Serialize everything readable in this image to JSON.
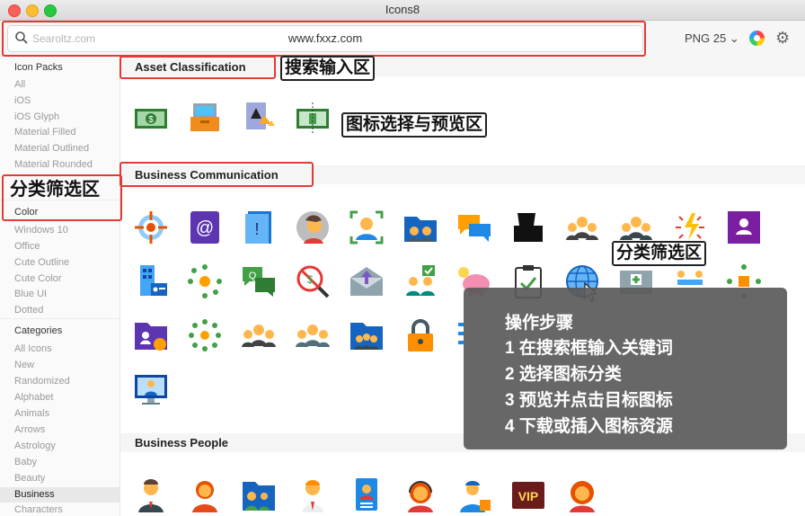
{
  "window": {
    "title": "Icons8"
  },
  "toolbar": {
    "search_placeholder": "Searoltz.com",
    "search_value": "www.fxxz.com",
    "format_label": "PNG 25 ⌄",
    "icons": [
      "search-icon",
      "color-picker-icon",
      "gear-icon"
    ]
  },
  "sidebar": {
    "icon_packs_title": "Icon Packs",
    "packs": [
      "All",
      "iOS",
      "iOS Glyph",
      "Material Filled",
      "Material Outlined",
      "Material Rounded"
    ],
    "color_title": "Color",
    "color_packs": [
      "Windows 10",
      "Office",
      "Cute Outline",
      "Cute Color",
      "Blue UI",
      "Dotted"
    ],
    "categories_title": "Categories",
    "categories": [
      "All Icons",
      "New",
      "Randomized",
      "Alphabet",
      "Animals",
      "Arrows",
      "Astrology",
      "Baby",
      "Beauty",
      "Business",
      "Characters"
    ],
    "selected_category": "Business"
  },
  "sections": {
    "asset": "Asset Classification",
    "communication": "Business Communication",
    "people": "Business People"
  },
  "annotations": {
    "search_area": "搜索输入区",
    "preview_area": "图标选择与预览区",
    "filter_area_left": "分类筛选区",
    "filter_area_right": "分类筛选区"
  },
  "steps": {
    "title": "操作步骤",
    "items": [
      "1 在搜索框输入关键词",
      "2 选择图标分类",
      "3 预览并点击目标图标",
      "4 下载或插入图标资源"
    ]
  },
  "icon_labels": {
    "vip": "VIP",
    "at": "@",
    "info": "!",
    "q": "Q"
  }
}
